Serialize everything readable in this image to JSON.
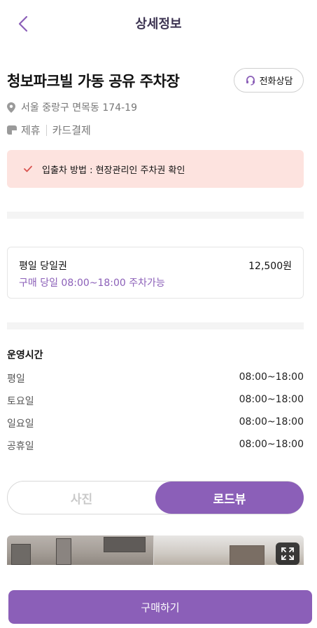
{
  "header": {
    "title": "상세정보",
    "back_icon": "chevron-left-icon"
  },
  "lot": {
    "name": "청보파크빌 가동 공유 주차장",
    "call_label": "전화상담",
    "call_icon": "headset-icon",
    "address": "서울 중랑구 면목동 174-19",
    "address_icon": "location-pin-icon",
    "tag_icon": "card-icon",
    "tags": [
      "제휴",
      "카드결제"
    ]
  },
  "notice": {
    "icon": "check-icon",
    "text": "입출차 방법 : 현장관리인 주차권 확인"
  },
  "ticket": {
    "name": "평일 당일권",
    "price": "12,500원",
    "description": "구매 당일 08:00~18:00 주차가능"
  },
  "hours": {
    "title": "운영시간",
    "rows": [
      {
        "day": "평일",
        "time": "08:00~18:00"
      },
      {
        "day": "토요일",
        "time": "08:00~18:00"
      },
      {
        "day": "일요일",
        "time": "08:00~18:00"
      },
      {
        "day": "공휴일",
        "time": "08:00~18:00"
      }
    ]
  },
  "view_toggle": {
    "options": [
      "사진",
      "로드뷰"
    ],
    "selected": "로드뷰"
  },
  "photo": {
    "expand_icon": "expand-icon"
  },
  "purchase": {
    "label": "구매하기"
  },
  "colors": {
    "accent": "#8b5fb8",
    "notice_bg": "#fde3df",
    "title": "#3d3452"
  }
}
